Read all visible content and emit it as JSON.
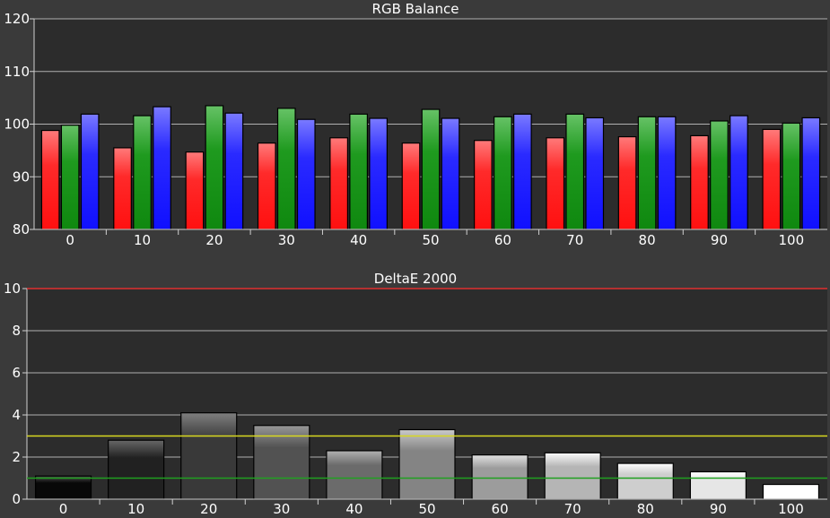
{
  "chart_data": [
    {
      "type": "bar",
      "title": "RGB Balance",
      "categories": [
        "0",
        "10",
        "20",
        "30",
        "40",
        "50",
        "60",
        "70",
        "80",
        "90",
        "100"
      ],
      "ylim": [
        80,
        120
      ],
      "yticks": [
        "80",
        "90",
        "100",
        "110",
        "120"
      ],
      "grid": true,
      "series": [
        {
          "color": "#ff2020",
          "values": [
            98.8,
            95.5,
            94.7,
            96.4,
            97.4,
            96.4,
            96.9,
            97.4,
            97.6,
            97.8,
            99.0
          ]
        },
        {
          "color": "#1e9a1e",
          "values": [
            99.8,
            101.6,
            103.5,
            103.0,
            101.9,
            102.8,
            101.4,
            101.9,
            101.4,
            100.6,
            100.2
          ]
        },
        {
          "color": "#2a2aff",
          "values": [
            101.9,
            103.3,
            102.1,
            100.9,
            101.1,
            101.1,
            101.9,
            101.2,
            101.4,
            101.6,
            101.2
          ]
        }
      ]
    },
    {
      "type": "bar",
      "title": "DeltaE 2000",
      "categories": [
        "0",
        "10",
        "20",
        "30",
        "40",
        "50",
        "60",
        "70",
        "80",
        "90",
        "100"
      ],
      "ylim": [
        0,
        10
      ],
      "yticks": [
        "0",
        "2",
        "4",
        "6",
        "8",
        "10"
      ],
      "grid": true,
      "values": [
        1.1,
        2.8,
        4.1,
        3.5,
        2.3,
        3.3,
        2.1,
        2.2,
        1.7,
        1.3,
        0.7
      ],
      "reference_lines": [
        {
          "value": 10,
          "color": "#e03030"
        },
        {
          "value": 3,
          "color": "#d8d820"
        },
        {
          "value": 1,
          "color": "#20a020"
        }
      ]
    }
  ]
}
